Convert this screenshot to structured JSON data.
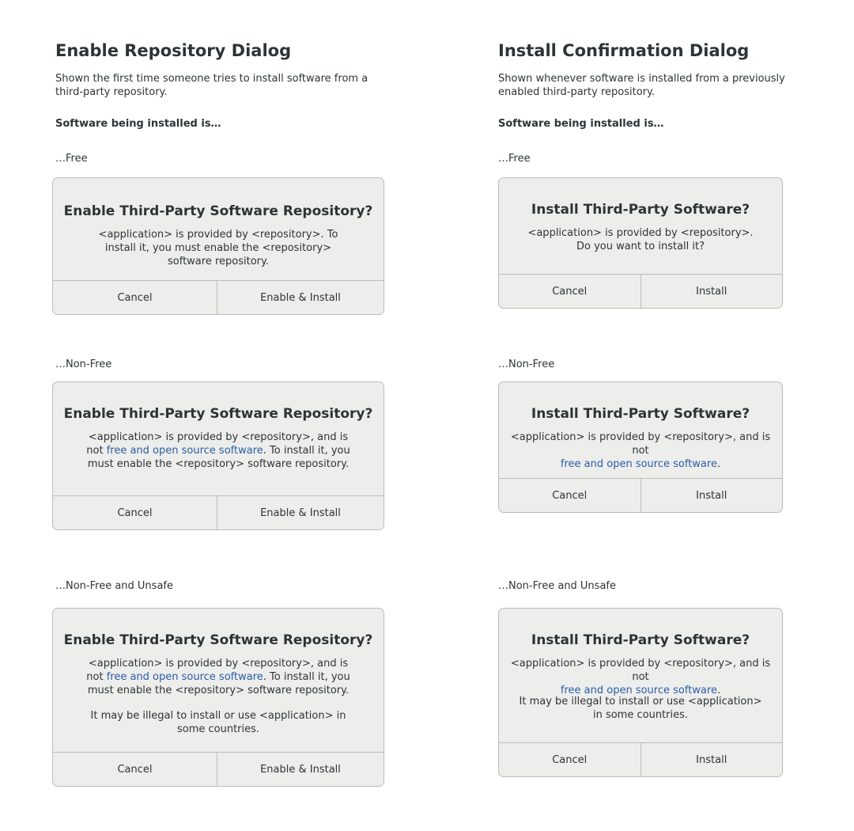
{
  "left": {
    "title": "Enable Repository Dialog",
    "description": "Shown the first time someone tries to install software from a third-party repository.",
    "lead": "Software being installed is…",
    "variants": [
      {
        "label": "…Free",
        "dialog_title": "Enable Third-Party Software Repository?",
        "body": "<application> is provided by <repository>. To install it, you must enable the <repository> software repository.",
        "cancel": "Cancel",
        "action": "Enable & Install"
      },
      {
        "label": "…Non-Free",
        "dialog_title": "Enable Third-Party Software Repository?",
        "body_pre": "<application> is provided by <repository>, and is not",
        "link": "free and open source software",
        "body_post": ". To install it, you must enable the <repository> software repository.",
        "cancel": "Cancel",
        "action": "Enable & Install"
      },
      {
        "label": "…Non-Free and Unsafe",
        "dialog_title": "Enable Third-Party Software Repository?",
        "body_pre": "<application> is provided by <repository>, and is not",
        "link": "free and open source software",
        "body_post": ". To install it, you must enable the <repository> software repository.",
        "warning": "It may be illegal to install or use <application> in some countries.",
        "cancel": "Cancel",
        "action": "Enable & Install"
      }
    ]
  },
  "right": {
    "title": "Install Confirmation Dialog",
    "description": "Shown whenever software is installed from a previously enabled third-party repository.",
    "lead": "Software being installed is…",
    "variants": [
      {
        "label": "…Free",
        "dialog_title": "Install Third-Party Software?",
        "body_line1": "<application> is provided by <repository>.",
        "body_line2": "Do you want to install it?",
        "cancel": "Cancel",
        "action": "Install"
      },
      {
        "label": "…Non-Free",
        "dialog_title": "Install Third-Party Software?",
        "body_pre": "<application> is provided by <repository>, and is not",
        "link": "free and open source software",
        "body_post": ".",
        "cancel": "Cancel",
        "action": "Install"
      },
      {
        "label": "…Non-Free and Unsafe",
        "dialog_title": "Install Third-Party Software?",
        "body_pre": "<application> is provided by <repository>, and is not",
        "link": "free and open source software",
        "body_post": ".",
        "warning_line1": "It may be illegal to install or use <application>",
        "warning_line2": "in some countries.",
        "cancel": "Cancel",
        "action": "Install"
      }
    ]
  },
  "colors": {
    "link": "#2a5ea8",
    "dialog_bg": "#ededeb",
    "border": "#bcbcb8",
    "text": "#2e3436"
  }
}
